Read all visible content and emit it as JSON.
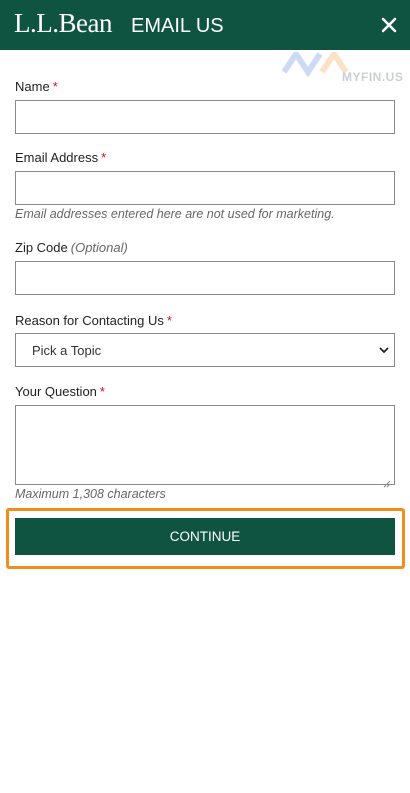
{
  "header": {
    "logo": "L.L.Bean",
    "title": "EMAIL US",
    "close_icon": "close-icon"
  },
  "watermark": {
    "text": "MYFIN.US"
  },
  "form": {
    "name": {
      "label": "Name",
      "required": "*",
      "value": ""
    },
    "email": {
      "label": "Email Address",
      "required": "*",
      "value": "",
      "hint": "Email addresses entered here are not used for marketing."
    },
    "zip": {
      "label": "Zip Code",
      "optional": "(Optional)",
      "value": ""
    },
    "reason": {
      "label": "Reason for Contacting Us",
      "required": "*",
      "selected": "Pick a Topic",
      "icon": "chevron-down-icon"
    },
    "question": {
      "label": "Your Question",
      "required": "*",
      "value": "",
      "hint": "Maximum 1,308 characters"
    },
    "continue_label": "CONTINUE"
  },
  "colors": {
    "brand_green": "#0f5440",
    "required_red": "#c8102e",
    "highlight_orange": "#f28c1b"
  }
}
